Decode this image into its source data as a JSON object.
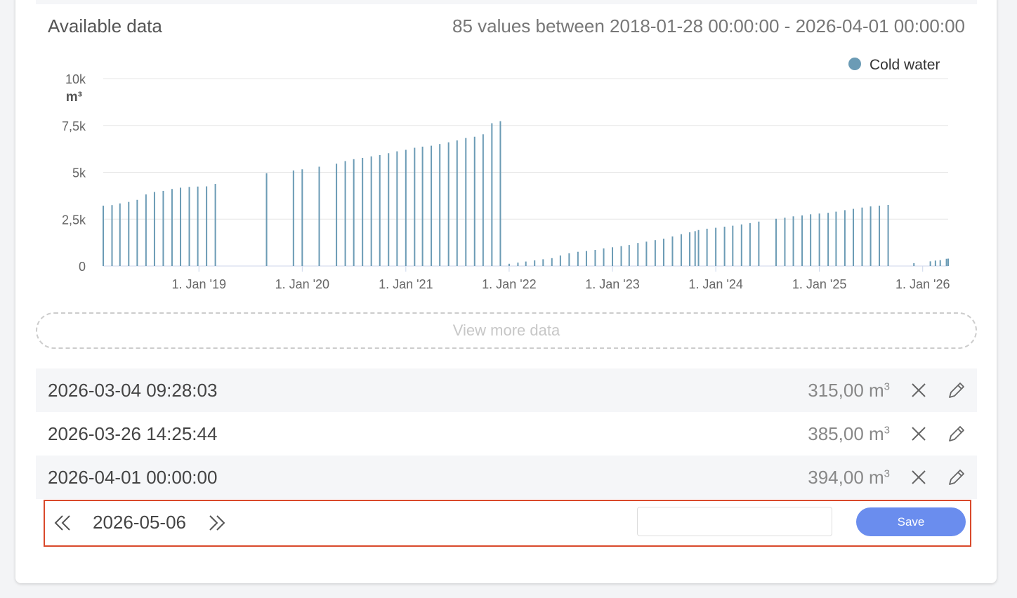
{
  "header": {
    "title": "Available data",
    "summary": "85 values between 2018-01-28 00:00:00 - 2026-04-01 00:00:00"
  },
  "chart_data": {
    "type": "bar",
    "legend": {
      "name": "Cold water",
      "color": "#6b9bb5",
      "position": "top-right"
    },
    "unit_label": "m³",
    "y_ticks": [
      "0",
      "2,5k",
      "5k",
      "7,5k",
      "10k"
    ],
    "y_tick_values": [
      0,
      2500,
      5000,
      7500,
      10000
    ],
    "ylim": [
      0,
      10000
    ],
    "x_ticks": [
      "1. Jan '19",
      "1. Jan '20",
      "1. Jan '21",
      "1. Jan '22",
      "1. Jan '23",
      "1. Jan '24",
      "1. Jan '25",
      "1. Jan '26"
    ],
    "x_tick_dates": [
      "2019-01-01",
      "2020-01-01",
      "2021-01-01",
      "2022-01-01",
      "2023-01-01",
      "2024-01-01",
      "2025-01-01",
      "2026-01-01"
    ],
    "xlim": [
      "2018-01-28",
      "2026-04-01"
    ],
    "grid": true,
    "series": [
      {
        "name": "Cold water",
        "points": [
          [
            "2018-01-28",
            3220
          ],
          [
            "2018-02-28",
            3250
          ],
          [
            "2018-03-28",
            3340
          ],
          [
            "2018-04-28",
            3420
          ],
          [
            "2018-05-28",
            3530
          ],
          [
            "2018-06-28",
            3820
          ],
          [
            "2018-07-28",
            3950
          ],
          [
            "2018-08-28",
            4010
          ],
          [
            "2018-09-28",
            4110
          ],
          [
            "2018-10-28",
            4180
          ],
          [
            "2018-11-28",
            4220
          ],
          [
            "2018-12-28",
            4240
          ],
          [
            "2019-01-28",
            4250
          ],
          [
            "2019-02-28",
            4380
          ],
          [
            "2019-08-28",
            4950
          ],
          [
            "2019-12-01",
            5100
          ],
          [
            "2020-01-01",
            5160
          ],
          [
            "2020-03-01",
            5300
          ],
          [
            "2020-05-01",
            5460
          ],
          [
            "2020-06-01",
            5600
          ],
          [
            "2020-07-01",
            5700
          ],
          [
            "2020-08-01",
            5770
          ],
          [
            "2020-09-01",
            5850
          ],
          [
            "2020-10-01",
            5920
          ],
          [
            "2020-11-01",
            6020
          ],
          [
            "2020-12-01",
            6120
          ],
          [
            "2021-01-01",
            6200
          ],
          [
            "2021-02-01",
            6310
          ],
          [
            "2021-03-01",
            6370
          ],
          [
            "2021-04-01",
            6420
          ],
          [
            "2021-05-01",
            6510
          ],
          [
            "2021-06-01",
            6600
          ],
          [
            "2021-07-01",
            6700
          ],
          [
            "2021-08-01",
            6830
          ],
          [
            "2021-09-01",
            6900
          ],
          [
            "2021-10-01",
            7030
          ],
          [
            "2021-11-01",
            7620
          ],
          [
            "2021-12-01",
            7730
          ],
          [
            "2022-01-01",
            120
          ],
          [
            "2022-02-01",
            180
          ],
          [
            "2022-03-01",
            240
          ],
          [
            "2022-04-01",
            300
          ],
          [
            "2022-05-01",
            360
          ],
          [
            "2022-06-01",
            420
          ],
          [
            "2022-07-01",
            560
          ],
          [
            "2022-08-01",
            680
          ],
          [
            "2022-09-01",
            760
          ],
          [
            "2022-10-01",
            800
          ],
          [
            "2022-11-01",
            860
          ],
          [
            "2022-12-01",
            940
          ],
          [
            "2023-01-01",
            1000
          ],
          [
            "2023-02-01",
            1060
          ],
          [
            "2023-03-01",
            1120
          ],
          [
            "2023-04-01",
            1230
          ],
          [
            "2023-05-01",
            1300
          ],
          [
            "2023-06-01",
            1380
          ],
          [
            "2023-07-01",
            1460
          ],
          [
            "2023-08-01",
            1580
          ],
          [
            "2023-09-01",
            1700
          ],
          [
            "2023-10-01",
            1800
          ],
          [
            "2023-10-20",
            1860
          ],
          [
            "2023-11-01",
            1920
          ],
          [
            "2023-12-01",
            1990
          ],
          [
            "2024-01-01",
            2040
          ],
          [
            "2024-02-01",
            2100
          ],
          [
            "2024-03-01",
            2150
          ],
          [
            "2024-04-01",
            2220
          ],
          [
            "2024-05-01",
            2290
          ],
          [
            "2024-06-01",
            2370
          ],
          [
            "2024-08-01",
            2520
          ],
          [
            "2024-09-01",
            2580
          ],
          [
            "2024-10-01",
            2650
          ],
          [
            "2024-11-01",
            2700
          ],
          [
            "2024-12-01",
            2760
          ],
          [
            "2025-01-01",
            2800
          ],
          [
            "2025-02-01",
            2840
          ],
          [
            "2025-03-01",
            2900
          ],
          [
            "2025-04-01",
            2980
          ],
          [
            "2025-05-01",
            3050
          ],
          [
            "2025-06-01",
            3120
          ],
          [
            "2025-07-01",
            3180
          ],
          [
            "2025-08-01",
            3220
          ],
          [
            "2025-09-01",
            3260
          ],
          [
            "2025-12-01",
            150
          ],
          [
            "2026-01-28",
            250
          ],
          [
            "2026-02-15",
            290
          ],
          [
            "2026-03-04",
            315
          ],
          [
            "2026-03-26",
            385
          ],
          [
            "2026-04-01",
            394
          ]
        ]
      }
    ]
  },
  "view_more": {
    "label": "View more data"
  },
  "entries": [
    {
      "timestamp": "2026-03-04 09:28:03",
      "value": "315,00 m",
      "unit_sup": "3"
    },
    {
      "timestamp": "2026-03-26 14:25:44",
      "value": "385,00 m",
      "unit_sup": "3"
    },
    {
      "timestamp": "2026-04-01 00:00:00",
      "value": "394,00 m",
      "unit_sup": "3"
    }
  ],
  "new_entry": {
    "date": "2026-05-06",
    "input_value": "",
    "save_label": "Save"
  },
  "icons": {
    "prev": "chevrons-left-icon",
    "next": "chevrons-right-icon",
    "delete": "close-icon",
    "edit": "pencil-icon"
  },
  "colors": {
    "bar": "#6b9bb5",
    "save_button": "#6a8dee",
    "highlight_border": "#d9492b"
  }
}
